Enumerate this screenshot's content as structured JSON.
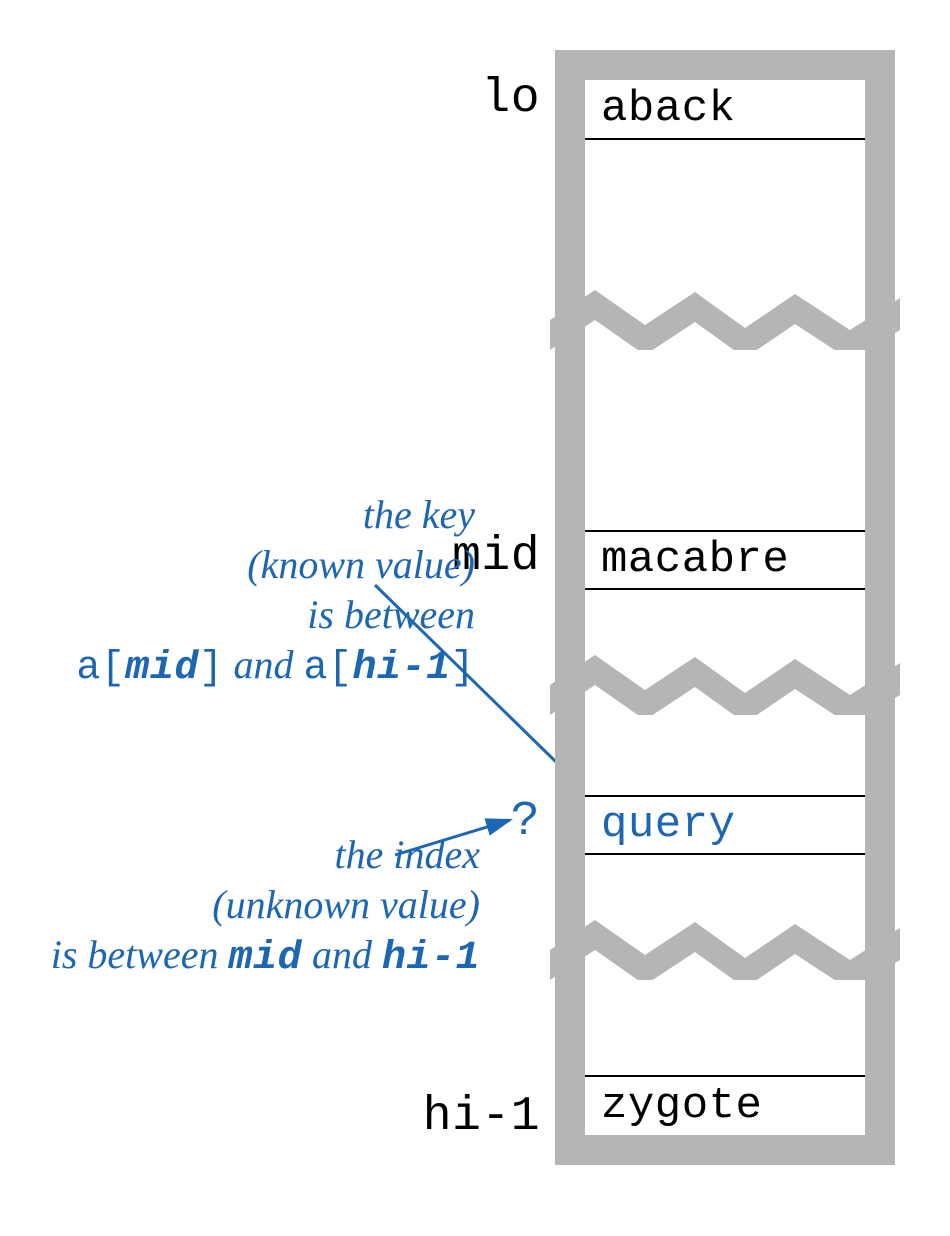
{
  "labels": {
    "lo": "lo",
    "mid": "mid",
    "q": "?",
    "hi": "hi-1"
  },
  "cells": {
    "lo": "aback",
    "mid": "macabre",
    "query": "query",
    "hi": "zygote"
  },
  "anno1": {
    "l1": "the key",
    "l2": "(known value)",
    "l3": "is between",
    "l4a": "a[",
    "l4b": "mid",
    "l4c": "]",
    "l4d": " and ",
    "l4e": "a[",
    "l4f": "hi-1",
    "l4g": "]"
  },
  "anno2": {
    "l1": "the index",
    "l2": "(unknown value)",
    "l3a": "is between ",
    "l3b": "mid",
    "l3c": " and ",
    "l3d": "hi-1"
  }
}
